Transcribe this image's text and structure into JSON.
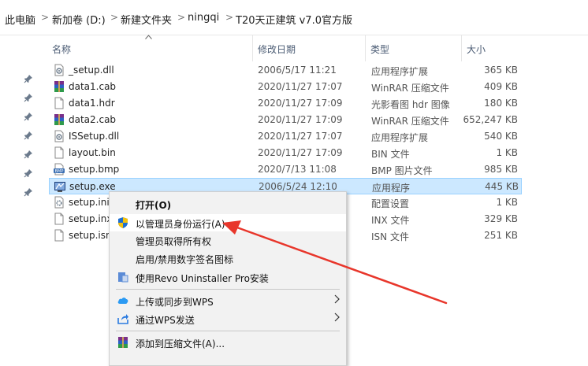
{
  "breadcrumb": {
    "items": [
      "此电脑",
      "新加卷 (D:)",
      "新建文件夹",
      "ningqi",
      "T20天正建筑 v7.0官方版"
    ],
    "separator": ">"
  },
  "columns": {
    "name": "名称",
    "date": "修改日期",
    "type": "类型",
    "size": "大小"
  },
  "files": [
    {
      "name": "_setup.dll",
      "date": "2006/5/17 11:21",
      "type": "应用程序扩展",
      "size": "365 KB",
      "icon": "dll-icon"
    },
    {
      "name": "data1.cab",
      "date": "2020/11/27 17:07",
      "type": "WinRAR 压缩文件",
      "size": "409 KB",
      "icon": "winrar-icon"
    },
    {
      "name": "data1.hdr",
      "date": "2020/11/27 17:09",
      "type": "光影看图 hdr 图像",
      "size": "180 KB",
      "icon": "file-icon"
    },
    {
      "name": "data2.cab",
      "date": "2020/11/27 17:09",
      "type": "WinRAR 压缩文件",
      "size": "652,247 KB",
      "icon": "winrar-icon"
    },
    {
      "name": "ISSetup.dll",
      "date": "2020/11/27 17:07",
      "type": "应用程序扩展",
      "size": "540 KB",
      "icon": "dll-icon"
    },
    {
      "name": "layout.bin",
      "date": "2020/11/27 17:09",
      "type": "BIN 文件",
      "size": "1 KB",
      "icon": "file-icon"
    },
    {
      "name": "setup.bmp",
      "date": "2020/7/13 11:08",
      "type": "BMP 图片文件",
      "size": "985 KB",
      "icon": "bmp-icon"
    },
    {
      "name": "setup.exe",
      "date": "2006/5/24 12:10",
      "type": "应用程序",
      "size": "445 KB",
      "icon": "exe-icon",
      "selected": true
    },
    {
      "name": "setup.ini",
      "date": "",
      "type": "配置设置",
      "size": "1 KB",
      "icon": "ini-icon"
    },
    {
      "name": "setup.inx",
      "date": "",
      "type": "INX 文件",
      "size": "329 KB",
      "icon": "file-icon"
    },
    {
      "name": "setup.isn",
      "date": "",
      "type": "ISN 文件",
      "size": "251 KB",
      "icon": "file-icon"
    }
  ],
  "context_menu": {
    "items": [
      {
        "label": "打开(O)",
        "bold": true
      },
      {
        "label": "以管理员身份运行(A)",
        "icon": "uac-shield-icon",
        "highlighted": true
      },
      {
        "label": "管理员取得所有权"
      },
      {
        "label": "启用/禁用数字签名图标"
      },
      {
        "label": "使用Revo Uninstaller Pro安装",
        "icon": "revo-icon"
      },
      {
        "label": "上传或同步到WPS",
        "icon": "wps-cloud-icon",
        "submenu": true
      },
      {
        "label": "通过WPS发送",
        "icon": "wps-share-icon",
        "submenu": true
      },
      {
        "label": "添加到压缩文件(A)...",
        "icon": "winrar-icon"
      }
    ]
  },
  "colors": {
    "selection_bg": "#cce8ff",
    "selection_border": "#99d1ff",
    "arrow": "#e8362b",
    "menu_bg": "#f2f2f2"
  }
}
